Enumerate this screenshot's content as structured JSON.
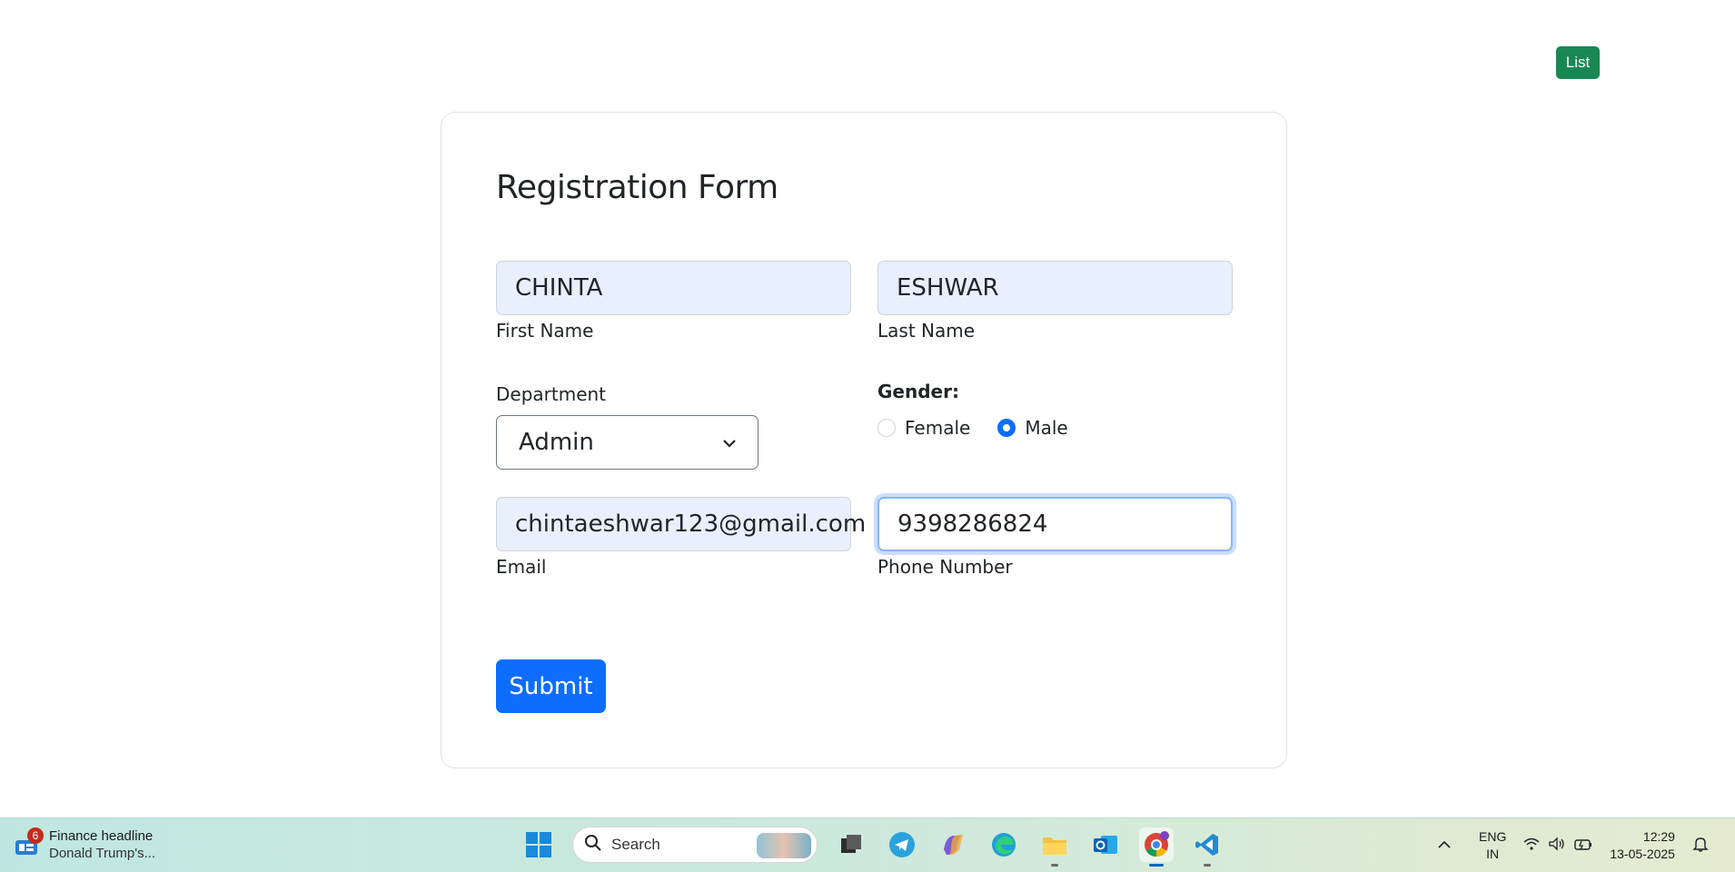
{
  "header": {
    "list_label": "List"
  },
  "form": {
    "title": "Registration Form",
    "first_name": {
      "value": "CHINTA",
      "label": "First Name"
    },
    "last_name": {
      "value": "ESHWAR",
      "label": "Last Name"
    },
    "department": {
      "label": "Department",
      "value": "Admin"
    },
    "gender": {
      "label": "Gender:",
      "options": [
        "Female",
        "Male"
      ],
      "selected": "Male"
    },
    "email": {
      "value": "chintaeshwar123@gmail.com",
      "label": "Email"
    },
    "phone": {
      "value": "9398286824",
      "label": "Phone Number"
    },
    "submit_label": "Submit"
  },
  "taskbar": {
    "news": {
      "badge": "6",
      "title": "Finance headline",
      "subtitle": "Donald Trump's..."
    },
    "search": {
      "label": "Search"
    },
    "pinned": [
      "start-icon",
      "task-view-icon",
      "telegram-icon",
      "copilot-icon",
      "edge-icon",
      "file-explorer-icon",
      "outlook-icon",
      "chrome-icon",
      "vscode-icon"
    ],
    "tray": {
      "lang_line1": "ENG",
      "lang_line2": "IN",
      "time": "12:29",
      "date": "13-05-2025"
    }
  }
}
